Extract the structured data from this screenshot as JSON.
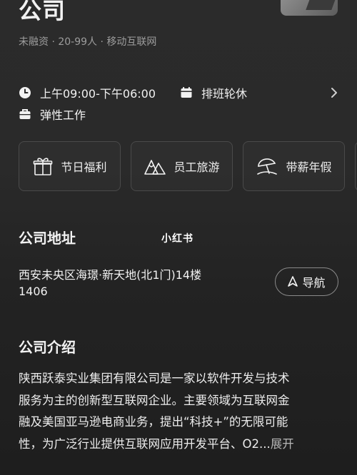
{
  "company": {
    "name": "公司",
    "meta": "未融资 · 20-99人 · 移动互联网"
  },
  "hours": {
    "time": "上午09:00-下午06:00",
    "schedule": "排班轮休",
    "work_mode": "弹性工作"
  },
  "benefits": [
    {
      "label": "节日福利",
      "icon": "gift-icon"
    },
    {
      "label": "员工旅游",
      "icon": "mountain-icon"
    },
    {
      "label": "带薪年假",
      "icon": "beach-umbrella-icon"
    }
  ],
  "address": {
    "title": "公司地址",
    "line1": "西安未央区海璟·新天地(北1门)14楼",
    "line2": "1406",
    "nav_label": "导航"
  },
  "watermark": "小红书",
  "intro": {
    "title": "公司介绍",
    "lines": [
      "陕西跃泰实业集团有限公司是一家以软件开发与技术",
      "服务为主的创新型互联网企业。主要领域为互联网金",
      "融及美国亚马逊电商业务，提出“科技+”的无限可能",
      "性，为广泛行业提供互联网应用开发平台、O2..."
    ],
    "expand_label": "展开"
  }
}
